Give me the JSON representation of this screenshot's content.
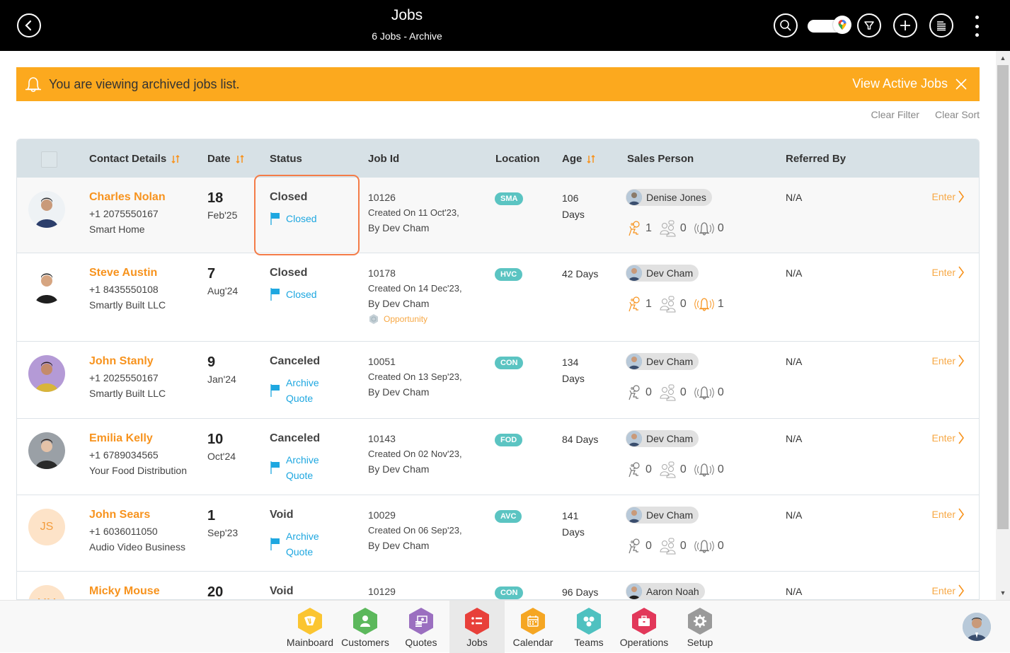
{
  "header": {
    "title": "Jobs",
    "subtitle": "6 Jobs - Archive",
    "icons": [
      "back-icon",
      "search-icon",
      "map-toggle",
      "filter-icon",
      "add-icon",
      "list-icon",
      "more-vertical-icon"
    ]
  },
  "banner": {
    "message": "You are viewing archived jobs list.",
    "link": "View Active Jobs",
    "color": "#fca91e"
  },
  "actions": {
    "clear_filter": "Clear Filter",
    "clear_sort": "Clear Sort"
  },
  "table": {
    "columns": {
      "contact": "Contact Details",
      "date": "Date",
      "status": "Status",
      "jobid": "Job Id",
      "location": "Location",
      "age": "Age",
      "sales": "Sales Person",
      "referred": "Referred By"
    },
    "rows": [
      {
        "name": "Charles Nolan",
        "phone": "+1 2075550167",
        "company": "Smart Home",
        "initials": "",
        "day": "18",
        "month": "Feb'25",
        "status": "Closed",
        "flag": "Closed",
        "flag2": "",
        "job_id": "10126",
        "created": "Created On 11 Oct'23,",
        "by": "By Dev Cham",
        "opportunity": "",
        "location": "SMA",
        "age": "106 Days",
        "sales_person": "Denise Jones",
        "count_visits": "1",
        "count_meetings": "0",
        "count_alerts": "0",
        "visits_active": true,
        "alerts_active": false,
        "referred_by": "N/A",
        "enter": "Enter"
      },
      {
        "name": "Steve Austin",
        "phone": "+1 8435550108",
        "company": "Smartly Built LLC",
        "initials": "",
        "day": "7",
        "month": "Aug'24",
        "status": "Closed",
        "flag": "Closed",
        "flag2": "",
        "job_id": "10178",
        "created": "Created On 14 Dec'23,",
        "by": "By Dev Cham",
        "opportunity": "Opportunity",
        "location": "HVC",
        "age": "42 Days",
        "sales_person": "Dev Cham",
        "count_visits": "1",
        "count_meetings": "0",
        "count_alerts": "1",
        "visits_active": true,
        "alerts_active": true,
        "referred_by": "N/A",
        "enter": "Enter"
      },
      {
        "name": "John Stanly",
        "phone": "+1 2025550167",
        "company": "Smartly Built LLC",
        "initials": "",
        "day": "9",
        "month": "Jan'24",
        "status": "Canceled",
        "flag": "Archive",
        "flag2": "Quote",
        "job_id": "10051",
        "created": "Created On 13 Sep'23,",
        "by": "By Dev Cham",
        "opportunity": "",
        "location": "CON",
        "age": "134 Days",
        "sales_person": "Dev Cham",
        "count_visits": "0",
        "count_meetings": "0",
        "count_alerts": "0",
        "visits_active": false,
        "alerts_active": false,
        "referred_by": "N/A",
        "enter": "Enter"
      },
      {
        "name": "Emilia Kelly",
        "phone": "+1 6789034565",
        "company": "Your Food Distribution",
        "initials": "",
        "day": "10",
        "month": "Oct'24",
        "status": "Canceled",
        "flag": "Archive",
        "flag2": "Quote",
        "job_id": "10143",
        "created": "Created On 02 Nov'23,",
        "by": "By Dev Cham",
        "opportunity": "",
        "location": "FOD",
        "age": "84 Days",
        "sales_person": "Dev Cham",
        "count_visits": "0",
        "count_meetings": "0",
        "count_alerts": "0",
        "visits_active": false,
        "alerts_active": false,
        "referred_by": "N/A",
        "enter": "Enter"
      },
      {
        "name": "John Sears",
        "phone": "+1 6036011050",
        "company": "Audio Video Business",
        "initials": "JS",
        "day": "1",
        "month": "Sep'23",
        "status": "Void",
        "flag": "Archive",
        "flag2": "Quote",
        "job_id": "10029",
        "created": "Created On 06 Sep'23,",
        "by": "By Dev Cham",
        "opportunity": "",
        "location": "AVC",
        "age": "141 Days",
        "sales_person": "Dev Cham",
        "count_visits": "0",
        "count_meetings": "0",
        "count_alerts": "0",
        "visits_active": false,
        "alerts_active": false,
        "referred_by": "N/A",
        "enter": "Enter"
      },
      {
        "name": "Micky Mouse",
        "phone": "",
        "company": "",
        "initials": "MM",
        "day": "20",
        "month": "",
        "status": "Void",
        "flag": "",
        "flag2": "",
        "job_id": "10129",
        "created": "",
        "by": "",
        "opportunity": "",
        "location": "CON",
        "age": "96 Days",
        "sales_person": "Aaron Noah",
        "count_visits": "",
        "count_meetings": "",
        "count_alerts": "",
        "visits_active": false,
        "alerts_active": false,
        "referred_by": "N/A",
        "enter": "Enter"
      }
    ]
  },
  "bottom_nav": {
    "items": [
      {
        "label": "Mainboard",
        "icon": "mainboard-icon",
        "color": "#fbc531"
      },
      {
        "label": "Customers",
        "icon": "customers-icon",
        "color": "#5cb85c"
      },
      {
        "label": "Quotes",
        "icon": "quotes-icon",
        "color": "#9b6fc0"
      },
      {
        "label": "Jobs",
        "icon": "jobs-icon",
        "color": "#e8403a",
        "active": true
      },
      {
        "label": "Calendar",
        "icon": "calendar-icon",
        "color": "#f5a623"
      },
      {
        "label": "Teams",
        "icon": "teams-icon",
        "color": "#4fc1c0"
      },
      {
        "label": "Operations",
        "icon": "operations-icon",
        "color": "#e2385a"
      },
      {
        "label": "Setup",
        "icon": "setup-icon",
        "color": "#9a9a9a"
      }
    ]
  },
  "colors": {
    "accent_orange": "#f7931e",
    "link_blue": "#1ea7e0",
    "location_badge": "#5bc4c2",
    "highlight_border": "#f47c48"
  }
}
